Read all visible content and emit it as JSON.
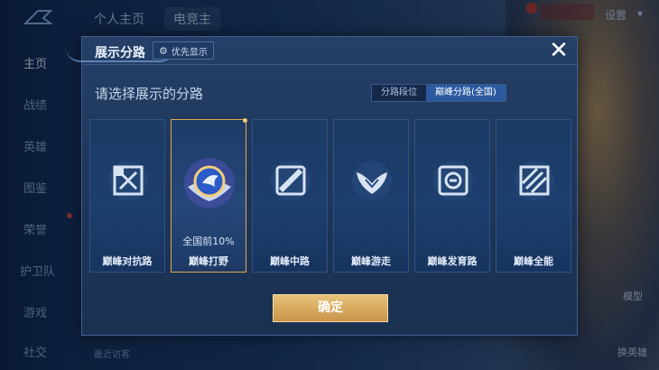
{
  "background": {
    "top_tabs": [
      "个人主页",
      "电竞主"
    ],
    "settings_label": "设置",
    "nav_items": [
      {
        "label": "主页",
        "active": true
      },
      {
        "label": "战绩",
        "active": false
      },
      {
        "label": "英雄",
        "active": false
      },
      {
        "label": "图鉴",
        "active": false
      },
      {
        "label": "荣誉",
        "active": false
      },
      {
        "label": "护卫队",
        "active": false
      },
      {
        "label": "游戏",
        "active": false
      },
      {
        "label": "社交",
        "active": false
      }
    ],
    "right_items": [
      "模型",
      "换英雄"
    ],
    "recent_label": "最近访客"
  },
  "dialog": {
    "title": "展示分路",
    "preference_label": "优先显示",
    "close_icon": "close-icon",
    "prompt": "请选择展示的分路",
    "segments": [
      {
        "label": "分路段位",
        "active": false
      },
      {
        "label": "巅峰分路(全国)",
        "active": true
      }
    ],
    "cards": [
      {
        "label": "巅峰对抗路",
        "icon": "clash-lane-icon",
        "selected": false,
        "rank": ""
      },
      {
        "label": "巅峰打野",
        "icon": "jungle-emblem-icon",
        "selected": true,
        "rank": "全国前10%"
      },
      {
        "label": "巅峰中路",
        "icon": "mid-lane-icon",
        "selected": false,
        "rank": ""
      },
      {
        "label": "巅峰游走",
        "icon": "roam-wings-icon",
        "selected": false,
        "rank": ""
      },
      {
        "label": "巅峰发育路",
        "icon": "farm-lane-icon",
        "selected": false,
        "rank": ""
      },
      {
        "label": "巅峰全能",
        "icon": "all-round-icon",
        "selected": false,
        "rank": ""
      }
    ],
    "confirm_label": "确定"
  },
  "colors": {
    "accent_gold": "#e0a84e",
    "segment_active": "#2b5aa0",
    "dialog_bg": "#1d3558"
  }
}
